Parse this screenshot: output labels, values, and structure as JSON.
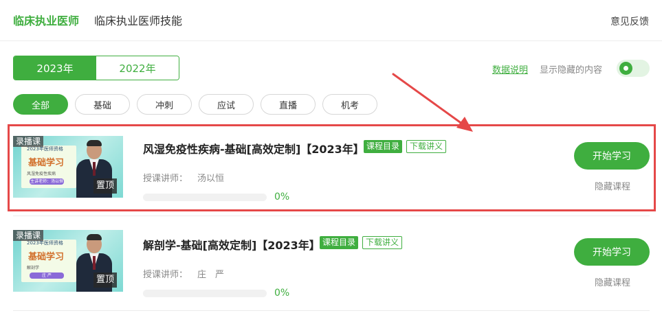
{
  "header": {
    "tabs": [
      {
        "label": "临床执业医师",
        "active": true
      },
      {
        "label": "临床执业医师技能",
        "active": false
      }
    ],
    "feedback_label": "意见反馈"
  },
  "year_switch": {
    "years": [
      {
        "label": "2023年",
        "active": true
      },
      {
        "label": "2022年",
        "active": false
      }
    ]
  },
  "options": {
    "data_note_label": "数据说明",
    "show_hidden_label": "显示隐藏的内容",
    "show_hidden_enabled": true
  },
  "filters": [
    {
      "label": "全部",
      "active": true
    },
    {
      "label": "基础",
      "active": false
    },
    {
      "label": "冲刺",
      "active": false
    },
    {
      "label": "应试",
      "active": false
    },
    {
      "label": "直播",
      "active": false
    },
    {
      "label": "机考",
      "active": false
    }
  ],
  "courses": [
    {
      "badge": "录播课",
      "pin_label": "置顶",
      "thumb_year": "2023年医师资格",
      "thumb_title": "基础学习",
      "thumb_subject": "风湿免疫性疾病",
      "thumb_teacher": "主讲老师：汤以恒",
      "title": "风湿免疫性疾病-基础[高效定制]【2023年】",
      "catalog_tag": "课程目录",
      "download_tag": "下载讲义",
      "teacher_label": "授课讲师：",
      "teacher_name": "汤以恒",
      "progress": 0,
      "progress_text": "0%",
      "start_label": "开始学习",
      "hide_label": "隐藏课程"
    },
    {
      "badge": "录播课",
      "pin_label": "置顶",
      "thumb_year": "2023年医师资格",
      "thumb_title": "基础学习",
      "thumb_subject": "解剖学",
      "thumb_teacher": "庄 严",
      "title": "解剖学-基础[高效定制]【2023年】",
      "catalog_tag": "课程目录",
      "download_tag": "下载讲义",
      "teacher_label": "授课讲师：",
      "teacher_name": "庄　严",
      "progress": 0,
      "progress_text": "0%",
      "start_label": "开始学习",
      "hide_label": "隐藏课程"
    }
  ],
  "colors": {
    "accent": "#3fae3f",
    "highlight": "#e54848"
  }
}
